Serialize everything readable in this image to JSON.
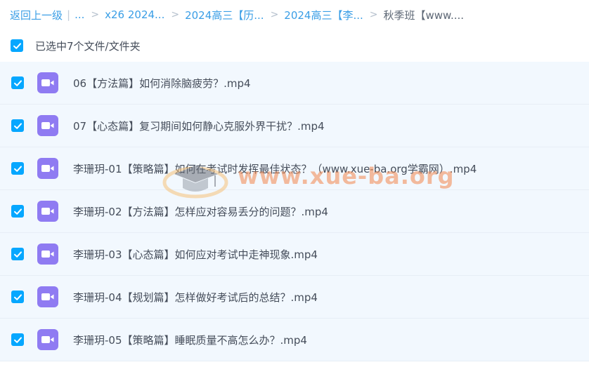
{
  "breadcrumb": {
    "back_label": "返回上一级",
    "ellipsis": "...",
    "items": [
      "x26 2024...",
      "2024高三【历...",
      "2024高三【李..."
    ],
    "current": "秋季班【www...."
  },
  "selection": {
    "text": "已选中7个文件/文件夹"
  },
  "files": [
    {
      "name": "06【方法篇】如何消除脑疲劳？.mp4"
    },
    {
      "name": "07【心态篇】复习期间如何静心克服外界干扰？.mp4"
    },
    {
      "name": "李珊玥-01【策略篇】如何在考试时发挥最佳状态？（www.xue-ba.org学霸网）.mp4"
    },
    {
      "name": "李珊玥-02【方法篇】怎样应对容易丢分的问题？.mp4"
    },
    {
      "name": "李珊玥-03【心态篇】如何应对考试中走神现象.mp4"
    },
    {
      "name": "李珊玥-04【规划篇】怎样做好考试后的总结？.mp4"
    },
    {
      "name": "李珊玥-05【策略篇】睡眠质量不高怎么办？.mp4"
    }
  ],
  "watermark": {
    "text": "www.xue-ba.org"
  },
  "colors": {
    "accent": "#06a7ff",
    "link": "#3a9ee6",
    "video_icon": "#8f7bf2",
    "row_background": "#f2f8fe",
    "watermark": "#f2874d"
  },
  "icons": {
    "checkbox": "checkmark-icon",
    "file": "video-file-icon",
    "watermark_logo": "graduation-cap-logo"
  }
}
